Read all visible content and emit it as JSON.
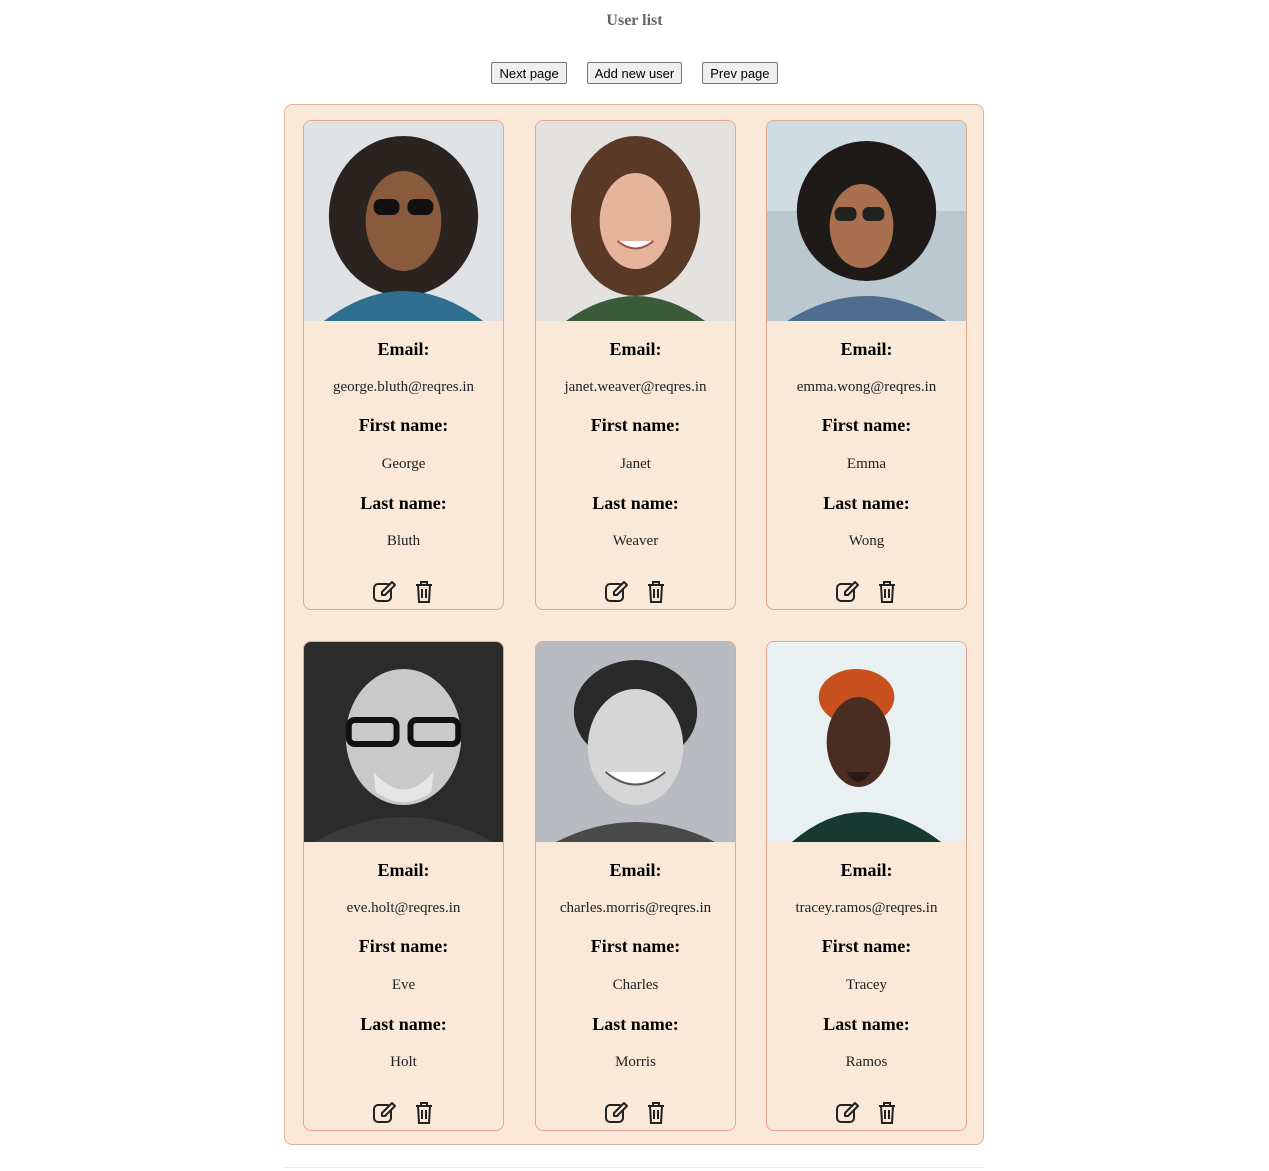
{
  "page": {
    "title": "User list"
  },
  "toolbar": {
    "next_label": "Next page",
    "add_label": "Add new user",
    "prev_label": "Prev page"
  },
  "labels": {
    "email": "Email:",
    "first_name": "First name:",
    "last_name": "Last name:"
  },
  "users": [
    {
      "email": "george.bluth@reqres.in",
      "first_name": "George",
      "last_name": "Bluth",
      "photo": "user-photo"
    },
    {
      "email": "janet.weaver@reqres.in",
      "first_name": "Janet",
      "last_name": "Weaver",
      "photo": "user-photo"
    },
    {
      "email": "emma.wong@reqres.in",
      "first_name": "Emma",
      "last_name": "Wong",
      "photo": "user-photo"
    },
    {
      "email": "eve.holt@reqres.in",
      "first_name": "Eve",
      "last_name": "Holt",
      "photo": "user-photo"
    },
    {
      "email": "charles.morris@reqres.in",
      "first_name": "Charles",
      "last_name": "Morris",
      "photo": "user-photo"
    },
    {
      "email": "tracey.ramos@reqres.in",
      "first_name": "Tracey",
      "last_name": "Ramos",
      "photo": "user-photo"
    }
  ],
  "icons": {
    "edit": "edit-icon",
    "delete": "trash-icon"
  },
  "colors": {
    "panel_background": "#fae9d8",
    "card_border": "#e5a58f",
    "title": "#666666"
  }
}
